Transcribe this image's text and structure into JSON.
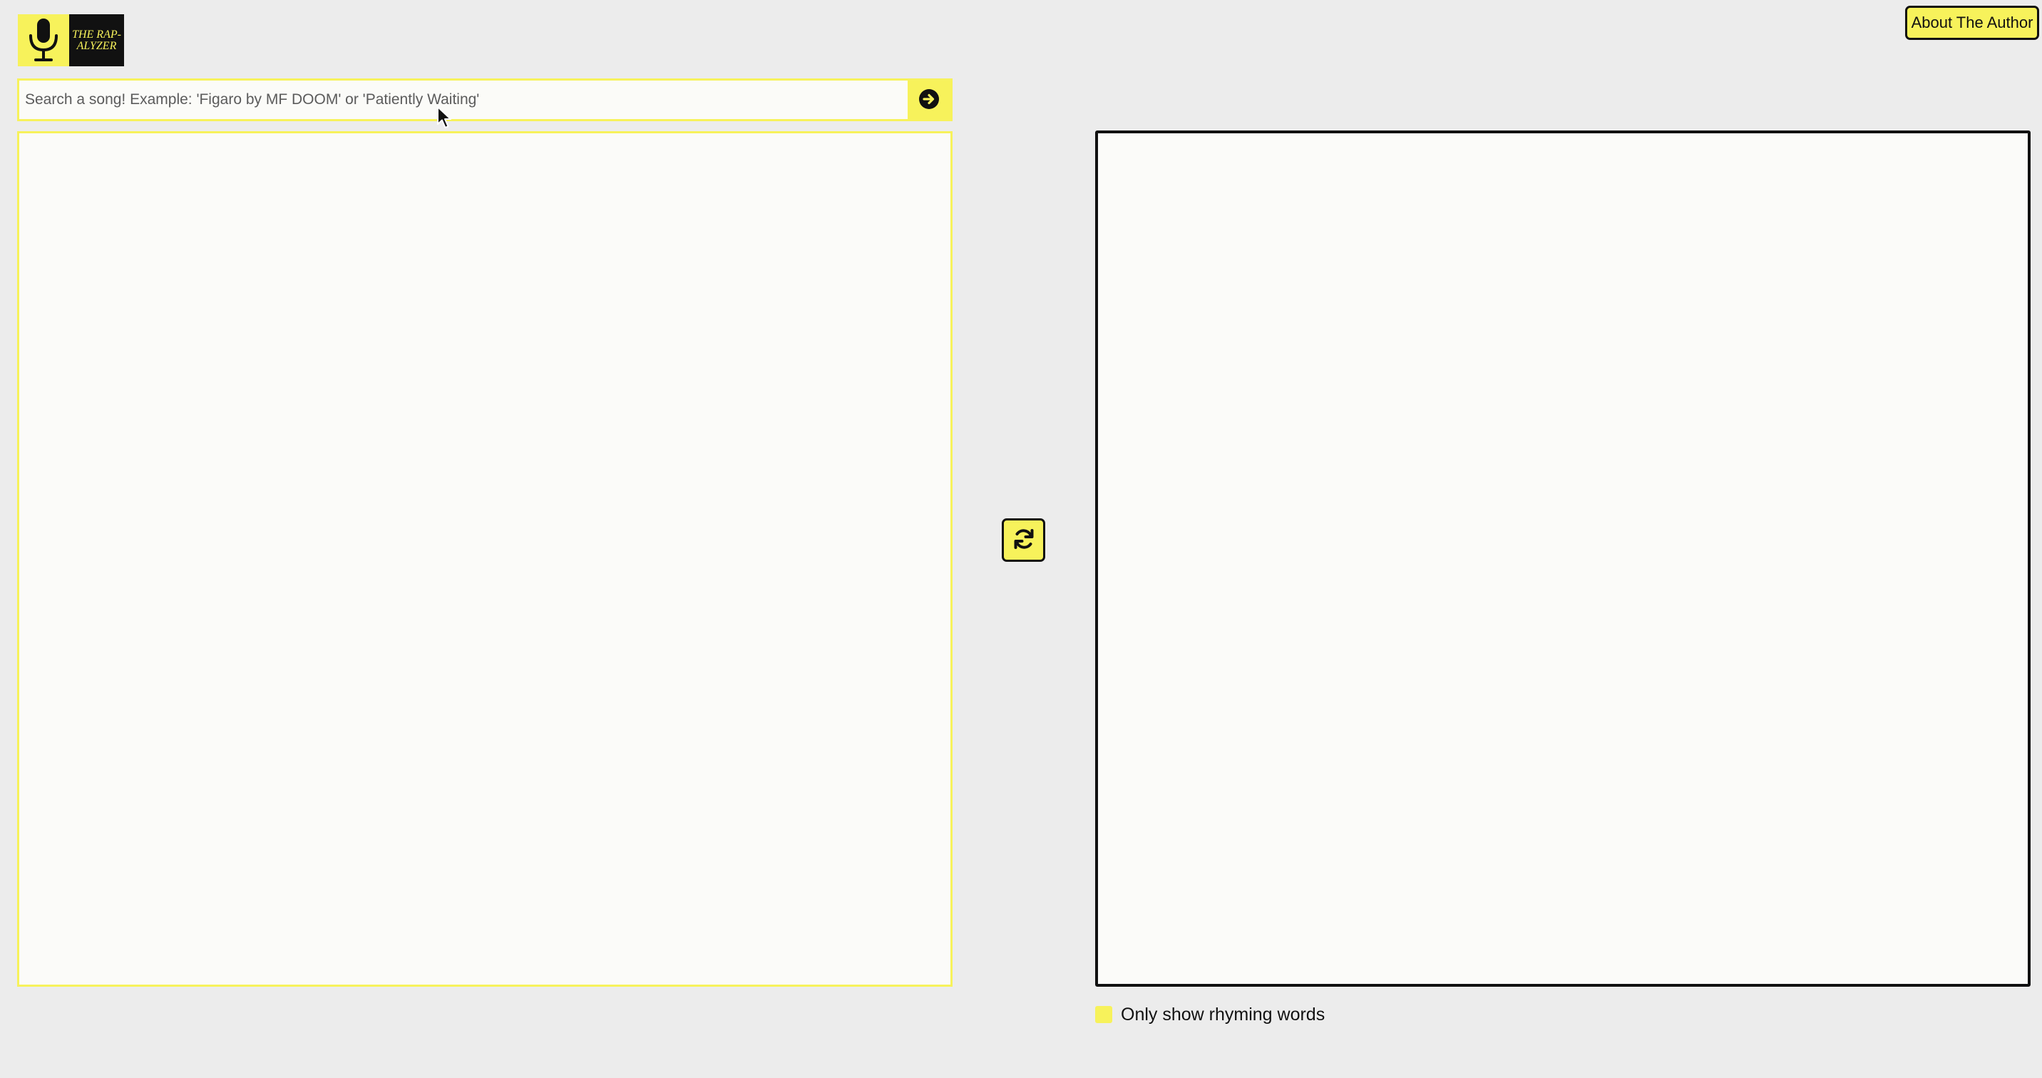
{
  "logo": {
    "line1": "THE RAP-",
    "line2": "ALYZER",
    "mic_icon": "microphone-icon"
  },
  "header": {
    "author_button_label": "About The Author"
  },
  "search": {
    "placeholder": "Search a song! Example: 'Figaro by MF DOOM' or 'Patiently Waiting'",
    "value": "",
    "submit_icon": "arrow-right-circle-icon"
  },
  "controls": {
    "swap_icon": "refresh-icon",
    "rhyme_toggle_label": "Only show rhyming words"
  },
  "colors": {
    "accent": "#f7f25b",
    "dark": "#111111",
    "background": "#ececec",
    "panel": "#fbfbf9"
  }
}
